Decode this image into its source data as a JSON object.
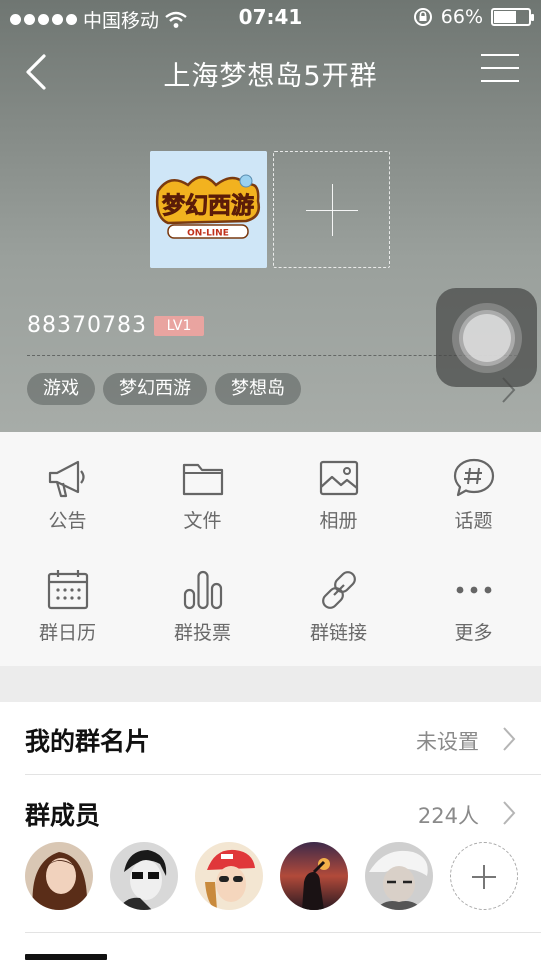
{
  "status_bar": {
    "carrier": "中国移动",
    "time": "07:41",
    "battery": "66%",
    "battery_level": 0.66
  },
  "navbar": {
    "title": "上海梦想岛5开群"
  },
  "group": {
    "logo_text_top": "梦幻西游",
    "logo_text_bottom": "ON-LINE",
    "id": "88370783",
    "level": "LV1",
    "tags": [
      "游戏",
      "梦幻西游",
      "梦想岛"
    ]
  },
  "functions": [
    {
      "label": "公告",
      "icon": "megaphone-icon"
    },
    {
      "label": "文件",
      "icon": "folder-icon"
    },
    {
      "label": "相册",
      "icon": "image-icon"
    },
    {
      "label": "话题",
      "icon": "topic-icon"
    },
    {
      "label": "群日历",
      "icon": "calendar-icon"
    },
    {
      "label": "群投票",
      "icon": "poll-icon"
    },
    {
      "label": "群链接",
      "icon": "link-icon"
    },
    {
      "label": "更多",
      "icon": "more-icon"
    }
  ],
  "card_row": {
    "title": "我的群名片",
    "value": "未设置"
  },
  "members_row": {
    "title": "群成员",
    "value": "224人"
  },
  "colors": {
    "hero_bg": "#8a908c",
    "level_badge": "#e9a4a0",
    "grid_bg": "#f7f7f7"
  }
}
